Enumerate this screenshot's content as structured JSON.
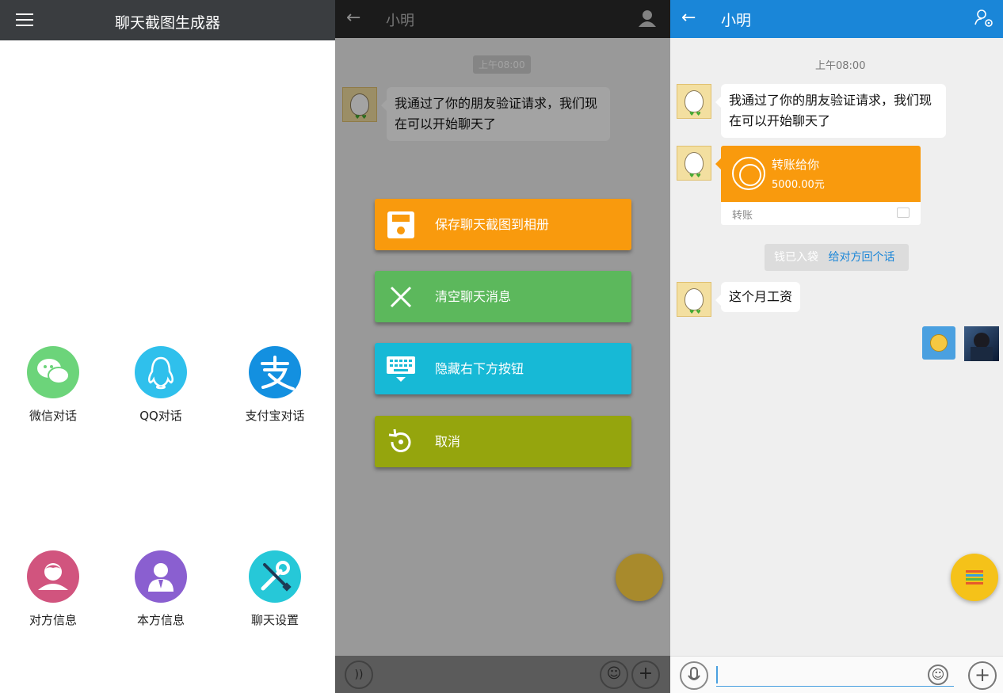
{
  "generator": {
    "title": "聊天截图生成器",
    "features": [
      {
        "label": "微信对话",
        "icon": "wechat-icon",
        "color": "#6cd47a"
      },
      {
        "label": "QQ对话",
        "icon": "qq-penguin-icon",
        "color": "#2fc0ec"
      },
      {
        "label": "支付宝对话",
        "icon": "alipay-icon",
        "color": "#1390e0"
      },
      {
        "label": "对方信息",
        "icon": "contact-person-icon",
        "color": "#d1547e"
      },
      {
        "label": "本方信息",
        "icon": "self-person-icon",
        "color": "#8a5fd0"
      },
      {
        "label": "聊天设置",
        "icon": "wrench-screwdriver-icon",
        "color": "#26c8d8"
      }
    ]
  },
  "menu_screen": {
    "contact_name": "小明",
    "time": "上午08:00",
    "message": "我通过了你的朋友验证请求，我们现在可以开始聊天了",
    "menu": [
      {
        "label": "保存聊天截图到相册",
        "color": "#f99a0d",
        "icon": "save-icon"
      },
      {
        "label": "清空聊天消息",
        "color": "#5cb85c",
        "icon": "clear-x-icon"
      },
      {
        "label": "隐藏右下方按钮",
        "color": "#17b9d6",
        "icon": "keyboard-hide-icon"
      },
      {
        "label": "取消",
        "color": "#95a50d",
        "icon": "undo-icon"
      }
    ]
  },
  "chat_screen": {
    "contact_name": "小明",
    "time": "上午08:00",
    "messages": {
      "first": "我通过了你的朋友验证请求，我们现在可以开始聊天了",
      "transfer_title": "转账给你",
      "transfer_amount": "5000.00元",
      "transfer_footer": "转账",
      "system_status": "钱已入袋",
      "system_link": "给对方回个话",
      "last": "这个月工资"
    }
  },
  "colors": {
    "p1_header": "#3a3d40",
    "p2_header": "#2b2b2b",
    "p3_header": "#1a86d8",
    "transfer_orange": "#f99a0d",
    "link_blue": "#1a86d8"
  }
}
